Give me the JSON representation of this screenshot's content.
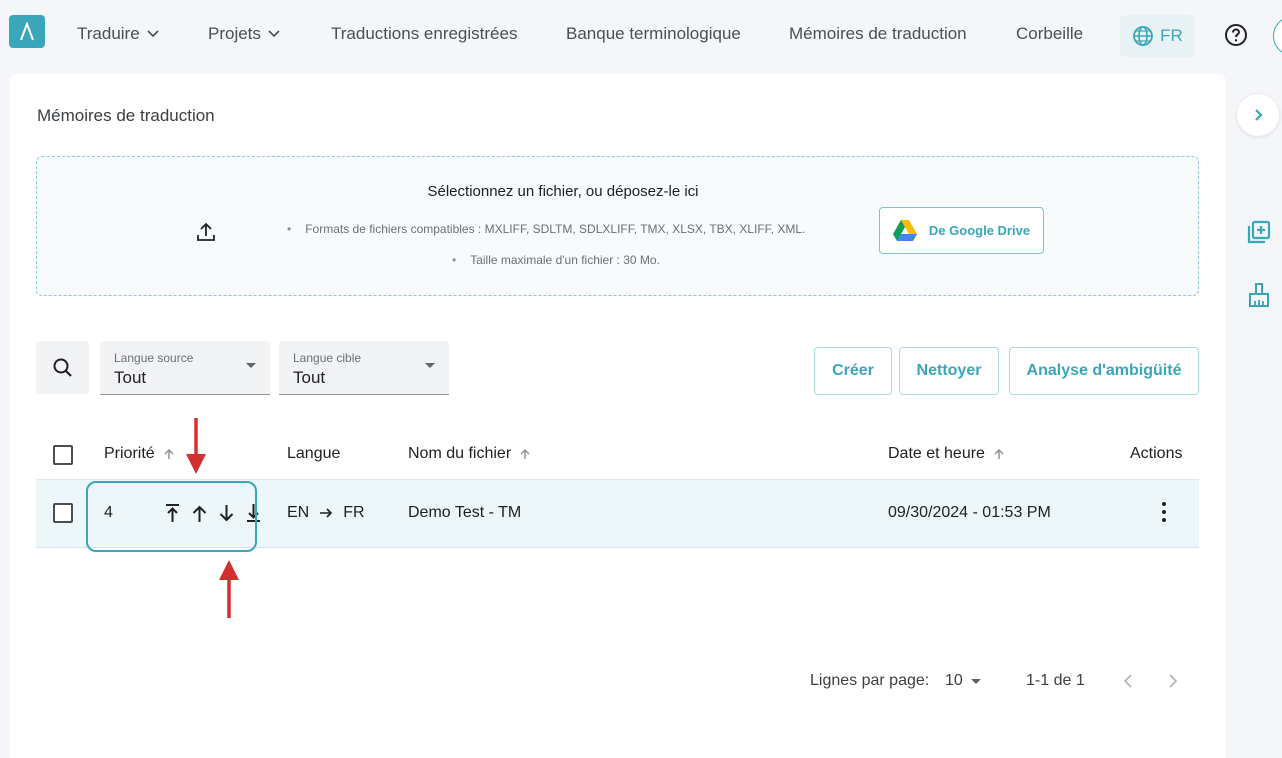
{
  "nav": {
    "logo_glyph": "Λ",
    "items": [
      {
        "label": "Traduire",
        "has_dropdown": true
      },
      {
        "label": "Projets",
        "has_dropdown": true
      },
      {
        "label": "Traductions enregistrées"
      },
      {
        "label": "Banque terminologique"
      },
      {
        "label": "Mémoires de traduction"
      },
      {
        "label": "Corbeille"
      }
    ],
    "language": "FR"
  },
  "page": {
    "title": "Mémoires de traduction"
  },
  "upload": {
    "title": "Sélectionnez un fichier, ou déposez-le ici",
    "formats": "Formats de fichiers compatibles : MXLIFF, SDLTM, SDLXLIFF, TMX, XLSX, TBX, XLIFF, XML.",
    "max_size": "Taille maximale d'un fichier : 30 Mo.",
    "gdrive_label": "De Google Drive"
  },
  "filters": {
    "source": {
      "label": "Langue source",
      "value": "Tout"
    },
    "target": {
      "label": "Langue cible",
      "value": "Tout"
    }
  },
  "actions": {
    "create": "Créer",
    "clean": "Nettoyer",
    "ambiguity": "Analyse d'ambigüité"
  },
  "table": {
    "headers": {
      "priority": "Priorité",
      "language": "Langue",
      "filename": "Nom du fichier",
      "datetime": "Date et heure",
      "actions": "Actions"
    },
    "rows": [
      {
        "priority": "4",
        "lang_source": "EN",
        "lang_target": "FR",
        "filename": "Demo Test - TM",
        "datetime": "09/30/2024 - 01:53 PM"
      }
    ]
  },
  "pagination": {
    "rows_label": "Lignes par page:",
    "rows_value": "10",
    "range": "1-1 de 1"
  },
  "colors": {
    "accent": "#3aa6b9",
    "annotation_arrow": "#d32f2f",
    "row_highlight": "#edf6f8"
  }
}
